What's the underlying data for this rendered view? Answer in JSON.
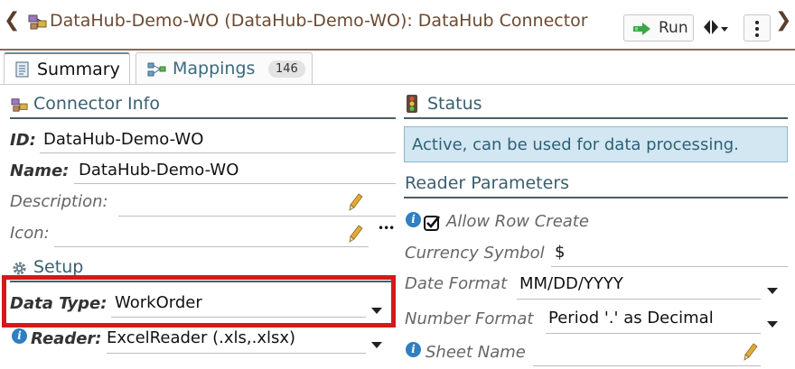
{
  "header": {
    "title": "DataHub-Demo-WO (DataHub-Demo-WO): DataHub Connector",
    "run_label": "Run",
    "icons": {
      "back": "chevron-left-icon",
      "forward": "chevron-right-icon",
      "title": "connector-icon",
      "run": "run-arrow-icon",
      "split": "split-view-icon",
      "more": "more-vertical-icon"
    }
  },
  "tabs": [
    {
      "label": "Summary",
      "active": true,
      "icon": "summary-icon"
    },
    {
      "label": "Mappings",
      "count": "146",
      "icon": "mappings-icon"
    }
  ],
  "connector_info": {
    "title": "Connector Info",
    "id_label": "ID:",
    "id_value": "DataHub-Demo-WO",
    "name_label": "Name:",
    "name_value": "DataHub-Demo-WO",
    "description_label": "Description:",
    "icon_label": "Icon:",
    "icon_more": "•••"
  },
  "setup": {
    "title": "Setup",
    "data_type_label": "Data Type:",
    "data_type_value": "WorkOrder",
    "reader_label": "Reader:",
    "reader_value": "ExcelReader (.xls,.xlsx)"
  },
  "status": {
    "title": "Status",
    "text": "Active, can be used for data processing."
  },
  "reader_parameters": {
    "title": "Reader Parameters",
    "allow_row_create_label": "Allow Row Create",
    "allow_row_create_checked": true,
    "currency_symbol_label": "Currency Symbol",
    "currency_symbol_value": "$",
    "date_format_label": "Date Format",
    "date_format_value": "MM/DD/YYYY",
    "number_format_label": "Number Format",
    "number_format_value": "Period '.' as Decimal",
    "sheet_name_label": "Sheet Name"
  },
  "colors": {
    "accent_brown": "#6b4a33",
    "section_title": "#3a5f6f",
    "status_bg": "#d2e7f1",
    "highlight_red": "#d4191c",
    "info_blue": "#2f7fc1"
  }
}
